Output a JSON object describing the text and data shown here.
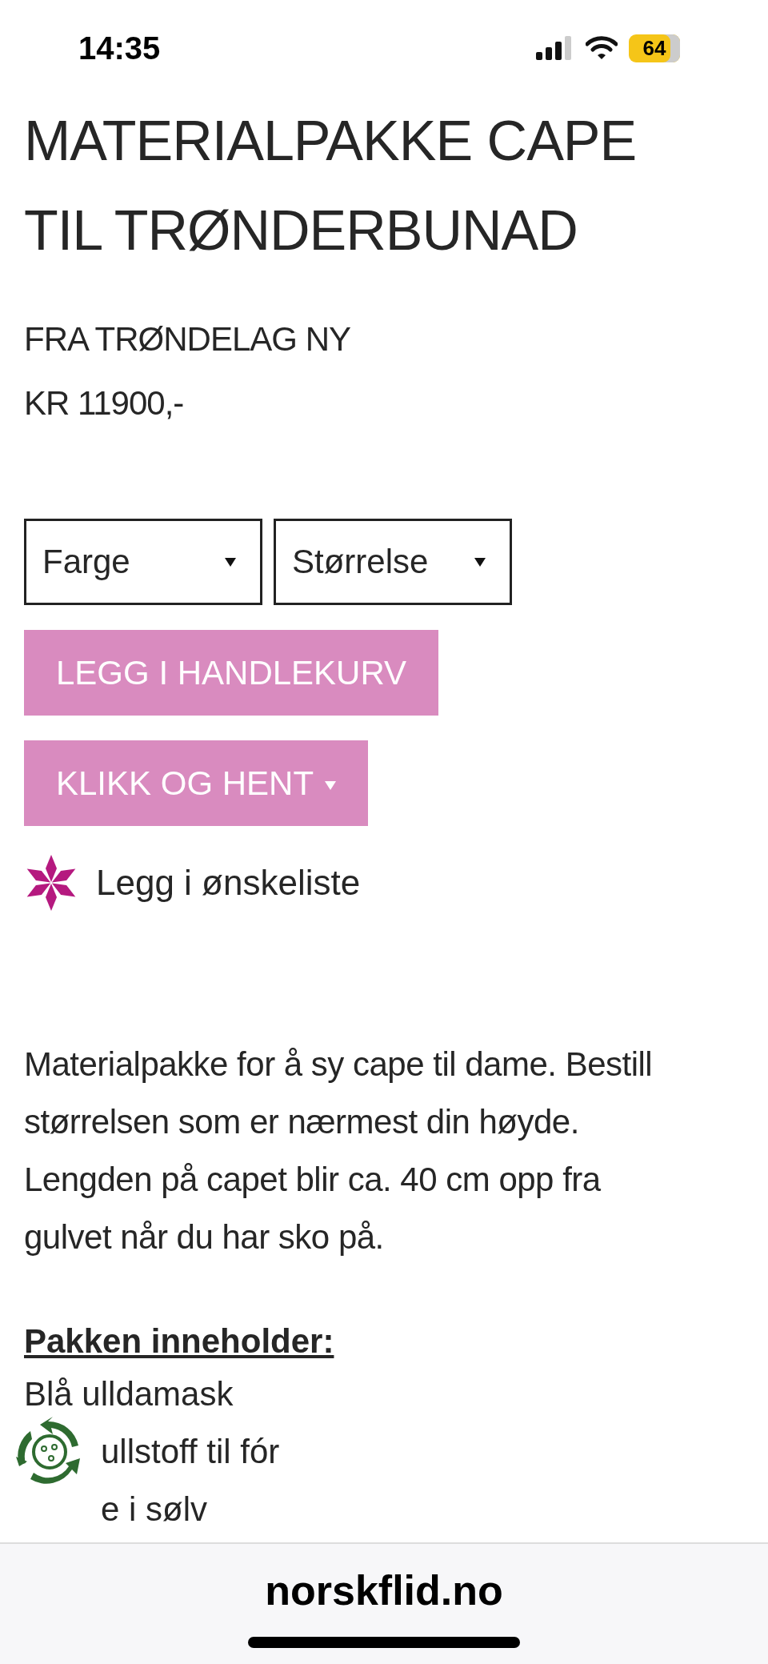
{
  "status_bar": {
    "time": "14:35",
    "battery": "64"
  },
  "product": {
    "title": "MATERIALPAKKE CAPE TIL TRØNDERBUNAD",
    "brand": "FRA TRØNDELAG NY",
    "price": "KR 11900,-"
  },
  "selects": [
    {
      "label": "Farge"
    },
    {
      "label": "Størrelse"
    }
  ],
  "buttons": [
    {
      "label": "LEGG I HANDLEKURV",
      "dropdown": false
    },
    {
      "label": "KLIKK OG HENT",
      "dropdown": true
    }
  ],
  "wishlist": {
    "label": "Legg i ønskeliste"
  },
  "description": "Materialpakke for å sy cape til dame. Bestill størrelsen som er nærmest din høyde. Lengden på capet blir ca. 40 cm opp fra gulvet når du har sko på.",
  "contents": {
    "heading": "Pakken inneholder:",
    "items": [
      "Blå ulldamask",
      "ullstoff til fór",
      "e i sølv"
    ]
  },
  "browser_bar": {
    "url": "norskflid.no"
  }
}
